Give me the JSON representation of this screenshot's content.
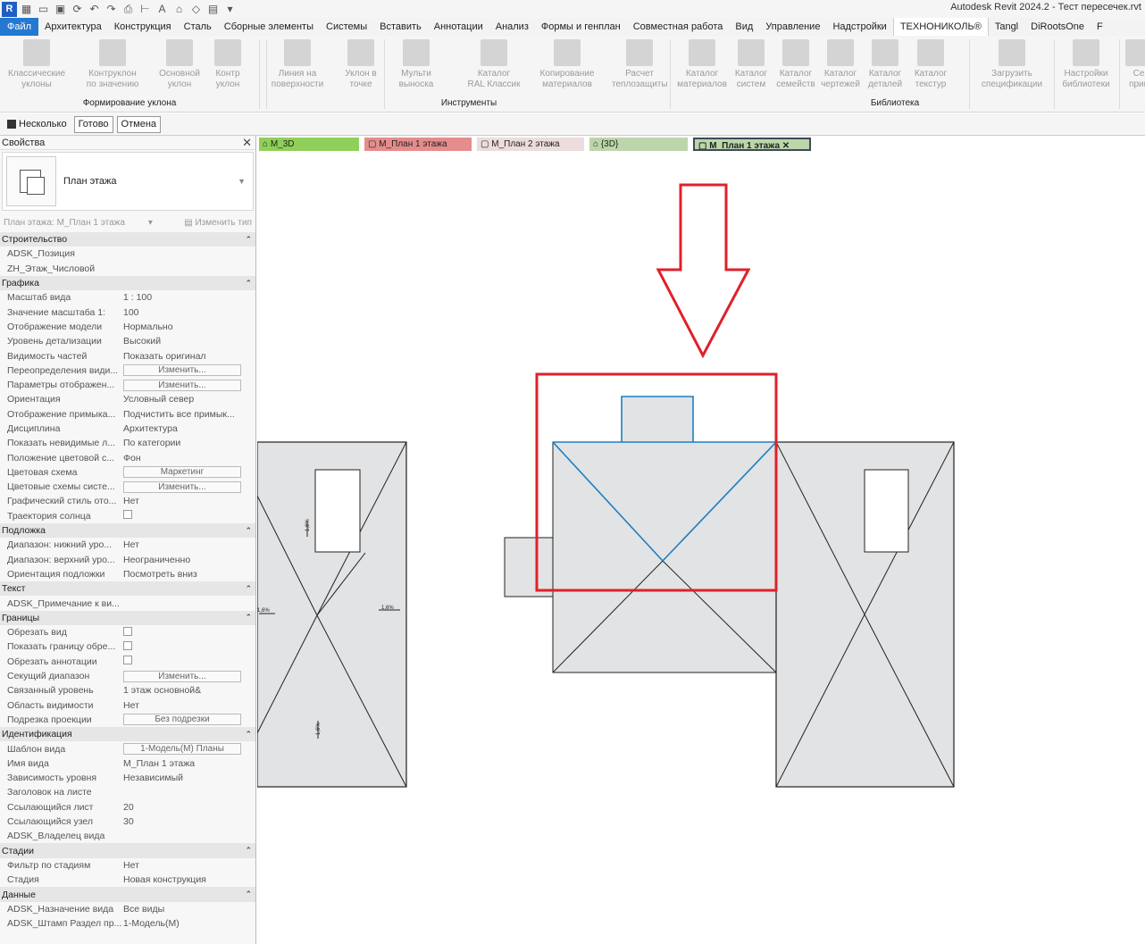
{
  "titlebar": {
    "logo": "R",
    "title": "Autodesk Revit 2024.2 - Тест пересечек.rvt"
  },
  "menu": [
    "Файл",
    "Архитектура",
    "Конструкция",
    "Сталь",
    "Сборные элементы",
    "Системы",
    "Вставить",
    "Аннотации",
    "Анализ",
    "Формы и генплан",
    "Совместная работа",
    "Вид",
    "Управление",
    "Надстройки",
    "ТЕХНОНИКОЛЬ®",
    "Tangl",
    "DiRootsOne",
    "F"
  ],
  "ribbon": {
    "buttons": [
      "Классические\nуклоны",
      "Контруклон\nпо значению",
      "Основной\nуклон",
      "Контр\nуклон",
      "Линия на\nповерхности",
      "Уклон в\nточке",
      "Мульти\nвыноска",
      "Каталог\nRAL Классик",
      "Копирование\nматериалов",
      "Расчет\nтеплозащиты",
      "Каталог\nматериалов",
      "Каталог\nсистем",
      "Каталог\nсемейств",
      "Каталог\nчертежей",
      "Каталог\nдеталей",
      "Каталог\nтекстур",
      "Загрузить\nспецификации",
      "Настройки\nбиблиотеки",
      "Се\nприв"
    ],
    "panels": [
      "Формирование уклона",
      "Инструменты",
      "Библиотека"
    ]
  },
  "options": {
    "multiple_label": "Несколько",
    "done": "Готово",
    "cancel": "Отмена"
  },
  "properties": {
    "title": "Свойства",
    "type_name": "План этажа",
    "instance": "План этажа: М_План 1 этажа",
    "edit_type": "Изменить тип",
    "groups": [
      {
        "name": "Строительство",
        "rows": [
          {
            "n": "ADSK_Позиция",
            "v": ""
          },
          {
            "n": "ZH_Этаж_Числовой",
            "v": ""
          }
        ]
      },
      {
        "name": "Графика",
        "rows": [
          {
            "n": "Масштаб вида",
            "v": "1 : 100"
          },
          {
            "n": "Значение масштаба    1:",
            "v": "100"
          },
          {
            "n": "Отображение модели",
            "v": "Нормально"
          },
          {
            "n": "Уровень детализации",
            "v": "Высокий"
          },
          {
            "n": "Видимость частей",
            "v": "Показать оригинал"
          },
          {
            "n": "Переопределения види...",
            "v": "Изменить...",
            "btn": true
          },
          {
            "n": "Параметры отображен...",
            "v": "Изменить...",
            "btn": true
          },
          {
            "n": "Ориентация",
            "v": "Условный север"
          },
          {
            "n": "Отображение примыка...",
            "v": "Подчистить все примык..."
          },
          {
            "n": "Дисциплина",
            "v": "Архитектура"
          },
          {
            "n": "Показать невидимые л...",
            "v": "По категории"
          },
          {
            "n": "Положение цветовой с...",
            "v": "Фон"
          },
          {
            "n": "Цветовая схема",
            "v": "Маркетинг",
            "btn": true
          },
          {
            "n": "Цветовые схемы систе...",
            "v": "Изменить...",
            "btn": true
          },
          {
            "n": "Графический стиль ото...",
            "v": "Нет"
          },
          {
            "n": "Траектория солнца",
            "v": "",
            "chk": true
          }
        ]
      },
      {
        "name": "Подложка",
        "rows": [
          {
            "n": "Диапазон: нижний уро...",
            "v": "Нет"
          },
          {
            "n": "Диапазон: верхний уро...",
            "v": "Неограниченно"
          },
          {
            "n": "Ориентация подложки",
            "v": "Посмотреть вниз"
          }
        ]
      },
      {
        "name": "Текст",
        "rows": [
          {
            "n": "ADSK_Примечание к ви...",
            "v": ""
          }
        ]
      },
      {
        "name": "Границы",
        "rows": [
          {
            "n": "Обрезать вид",
            "v": "",
            "chk": true
          },
          {
            "n": "Показать границу обре...",
            "v": "",
            "chk": true
          },
          {
            "n": "Обрезать аннотации",
            "v": "",
            "chk": true
          },
          {
            "n": "Секущий диапазон",
            "v": "Изменить...",
            "btn": true
          },
          {
            "n": "Связанный уровень",
            "v": "1 этаж основной&"
          },
          {
            "n": "Область видимости",
            "v": "Нет"
          },
          {
            "n": "Подрезка проекции",
            "v": "Без подрезки",
            "btn": true
          }
        ]
      },
      {
        "name": "Идентификация",
        "rows": [
          {
            "n": "Шаблон вида",
            "v": "1-Модель(М) Планы",
            "btn": true
          },
          {
            "n": "Имя вида",
            "v": "М_План 1 этажа"
          },
          {
            "n": "Зависимость уровня",
            "v": "Независимый"
          },
          {
            "n": "Заголовок на листе",
            "v": ""
          },
          {
            "n": "Ссылающийся лист",
            "v": "20"
          },
          {
            "n": "Ссылающийся узел",
            "v": "30"
          },
          {
            "n": "ADSK_Владелец вида",
            "v": ""
          }
        ]
      },
      {
        "name": "Стадии",
        "rows": [
          {
            "n": "Фильтр по стадиям",
            "v": "Нет"
          },
          {
            "n": "Стадия",
            "v": "Новая конструкция"
          }
        ]
      },
      {
        "name": "Данные",
        "rows": [
          {
            "n": "ADSK_Назначение вида",
            "v": "Все виды"
          },
          {
            "n": "ADSK_Штамп Раздел пр...",
            "v": "1-Модель(М)"
          }
        ]
      }
    ]
  },
  "view_tabs": [
    {
      "label": "М_3D",
      "color": "#8fcf5a"
    },
    {
      "label": "М_План 1 этажа",
      "color": "#e58c8c"
    },
    {
      "label": "М_План 2 этажа",
      "color": "#ecdcdc"
    },
    {
      "label": "{3D}",
      "color": "#bcd6aa"
    },
    {
      "label": "М_План 1 этажа",
      "color": "#bcd6aa",
      "active": true
    }
  ],
  "canvas": {
    "slope_labels": [
      "1,6%",
      "1,6%",
      "1,6%",
      "1,6%"
    ],
    "highlight_color": "#e0202a",
    "selection_color": "#1d7fbf",
    "roof_fill": "#e1e3e4"
  }
}
